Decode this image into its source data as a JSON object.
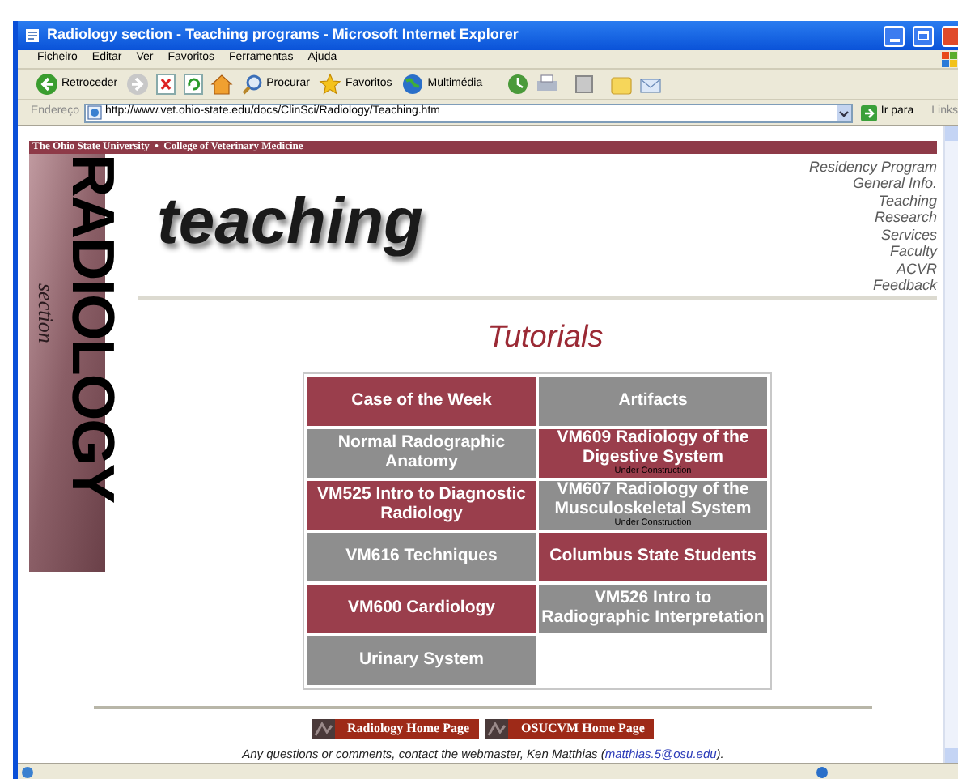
{
  "window": {
    "title": "Radiology section - Teaching programs - Microsoft Internet Explorer"
  },
  "menu": [
    "Ficheiro",
    "Editar",
    "Ver",
    "Favoritos",
    "Ferramentas",
    "Ajuda"
  ],
  "toolbar": [
    {
      "kind": "back",
      "label": "Retroceder"
    },
    {
      "kind": "search",
      "label": "Procurar"
    },
    {
      "kind": "favorites",
      "label": "Favoritos"
    },
    {
      "kind": "media",
      "label": "Multimédia"
    }
  ],
  "address": {
    "label": "Endereço",
    "url": "http://www.vet.ohio-state.edu/docs/ClinSci/Radiology/Teaching.htm",
    "go": "Ir para",
    "links": "Links"
  },
  "page": {
    "header_bar": "The Ohio State University  •  College of Veterinary Medicine",
    "banner": {
      "title": "RADIOLOGY",
      "subtitle": "section"
    },
    "heading": "teaching",
    "nav": [
      "Residency Program",
      "General Info.",
      "Teaching",
      "Research",
      "Services",
      "Faculty",
      "ACVR",
      "Feedback"
    ],
    "tutorials_title": "Tutorials",
    "tile_rows": [
      {
        "cells": [
          {
            "label": "Case of the Week",
            "color": "#9a3e4c"
          },
          {
            "label": "Artifacts",
            "color": "#8e8e8e"
          }
        ]
      },
      {
        "cells": [
          {
            "label": "Normal Radographic Anatomy",
            "color": "#8e8e8e"
          },
          {
            "label": "VM609 Radiology of the Digestive System",
            "note": "Under Construction",
            "color": "#9a3e4c"
          }
        ]
      },
      {
        "cells": [
          {
            "label": "VM525 Intro to Diagnostic Radiology",
            "color": "#9a3e4c"
          },
          {
            "label": "VM607 Radiology of the Musculoskeletal System",
            "note": "Under Construction",
            "color": "#8e8e8e"
          }
        ]
      },
      {
        "cells": [
          {
            "label": "VM616 Techniques",
            "color": "#8e8e8e"
          },
          {
            "label": "Columbus State Students",
            "color": "#9a3e4c"
          }
        ]
      },
      {
        "cells": [
          {
            "label": "VM600 Cardiology",
            "color": "#9a3e4c"
          },
          {
            "label": "VM526 Intro to Radiographic Interpretation",
            "color": "#8e8e8e"
          }
        ]
      },
      {
        "cells": [
          {
            "label": "Urinary System",
            "color": "#8e8e8e"
          }
        ]
      }
    ],
    "footer_buttons": [
      "Radiology Home Page",
      "OSUCVM Home Page"
    ],
    "contact": {
      "text": "Any questions or comments, contact the webmaster, Ken Matthias (",
      "link": "matthias.5@osu.edu",
      "end": ")."
    }
  }
}
